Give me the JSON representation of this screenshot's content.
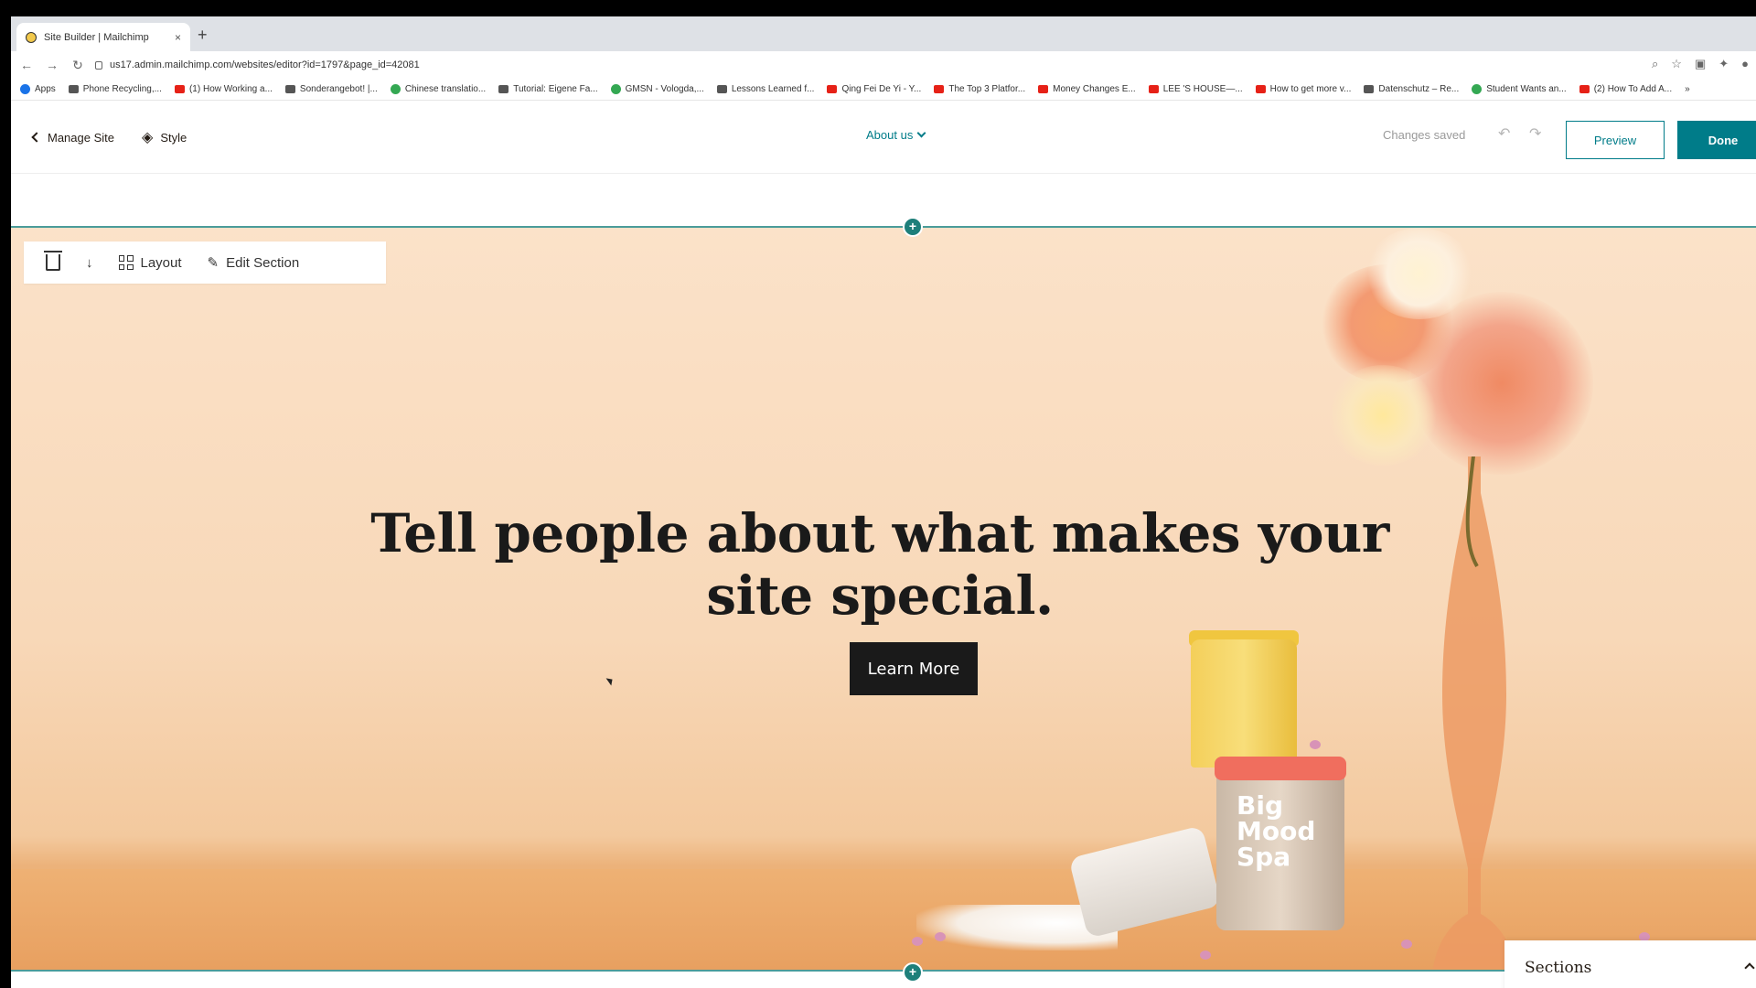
{
  "browser": {
    "tab_title": "Site Builder | Mailchimp",
    "tab_close": "×",
    "new_tab": "+",
    "url": "us17.admin.mailchimp.com/websites/editor?id=1797&page_id=42081",
    "bookmarks": [
      {
        "label": "Apps",
        "icon": "apps-grid-icon"
      },
      {
        "label": "Phone Recycling,...",
        "icon": "search-icon"
      },
      {
        "label": "(1) How Working a...",
        "icon": "youtube-icon"
      },
      {
        "label": "Sonderangebot! |...",
        "icon": "globe-icon"
      },
      {
        "label": "Chinese translatio...",
        "icon": "globe-icon"
      },
      {
        "label": "Tutorial: Eigene Fa...",
        "icon": "hash-icon"
      },
      {
        "label": "GMSN - Vologda,...",
        "icon": "globe-icon"
      },
      {
        "label": "Lessons Learned f...",
        "icon": "medium-icon"
      },
      {
        "label": "Qing Fei De Yi - Y...",
        "icon": "youtube-icon"
      },
      {
        "label": "The Top 3 Platfor...",
        "icon": "youtube-icon"
      },
      {
        "label": "Money Changes E...",
        "icon": "youtube-icon"
      },
      {
        "label": "LEE 'S HOUSE—...",
        "icon": "airbnb-icon"
      },
      {
        "label": "How to get more v...",
        "icon": "youtube-icon"
      },
      {
        "label": "Datenschutz – Re...",
        "icon": "page-icon"
      },
      {
        "label": "Student Wants an...",
        "icon": "globe-icon"
      },
      {
        "label": "(2) How To Add A...",
        "icon": "youtube-icon"
      }
    ],
    "bookmarks_overflow": "»"
  },
  "editor_header": {
    "manage_site": "Manage Site",
    "style": "Style",
    "page_select": "About us",
    "status": "Changes saved",
    "undo_icon": "↶",
    "redo_icon": "↷",
    "preview": "Preview",
    "done": "Done"
  },
  "section_toolbar": {
    "layout": "Layout",
    "edit_section": "Edit Section",
    "move_down_icon": "↓",
    "edit_icon": "✎"
  },
  "hero": {
    "title": "Tell people about what makes your site special.",
    "button": "Learn More",
    "jar_text": "Big Mood Spa",
    "add_section": "+"
  },
  "sections_panel": {
    "label": "Sections"
  },
  "colors": {
    "brand_teal": "#007c89",
    "hero_bg": "#f8d8b8",
    "button_dark": "#1a1a1a"
  }
}
